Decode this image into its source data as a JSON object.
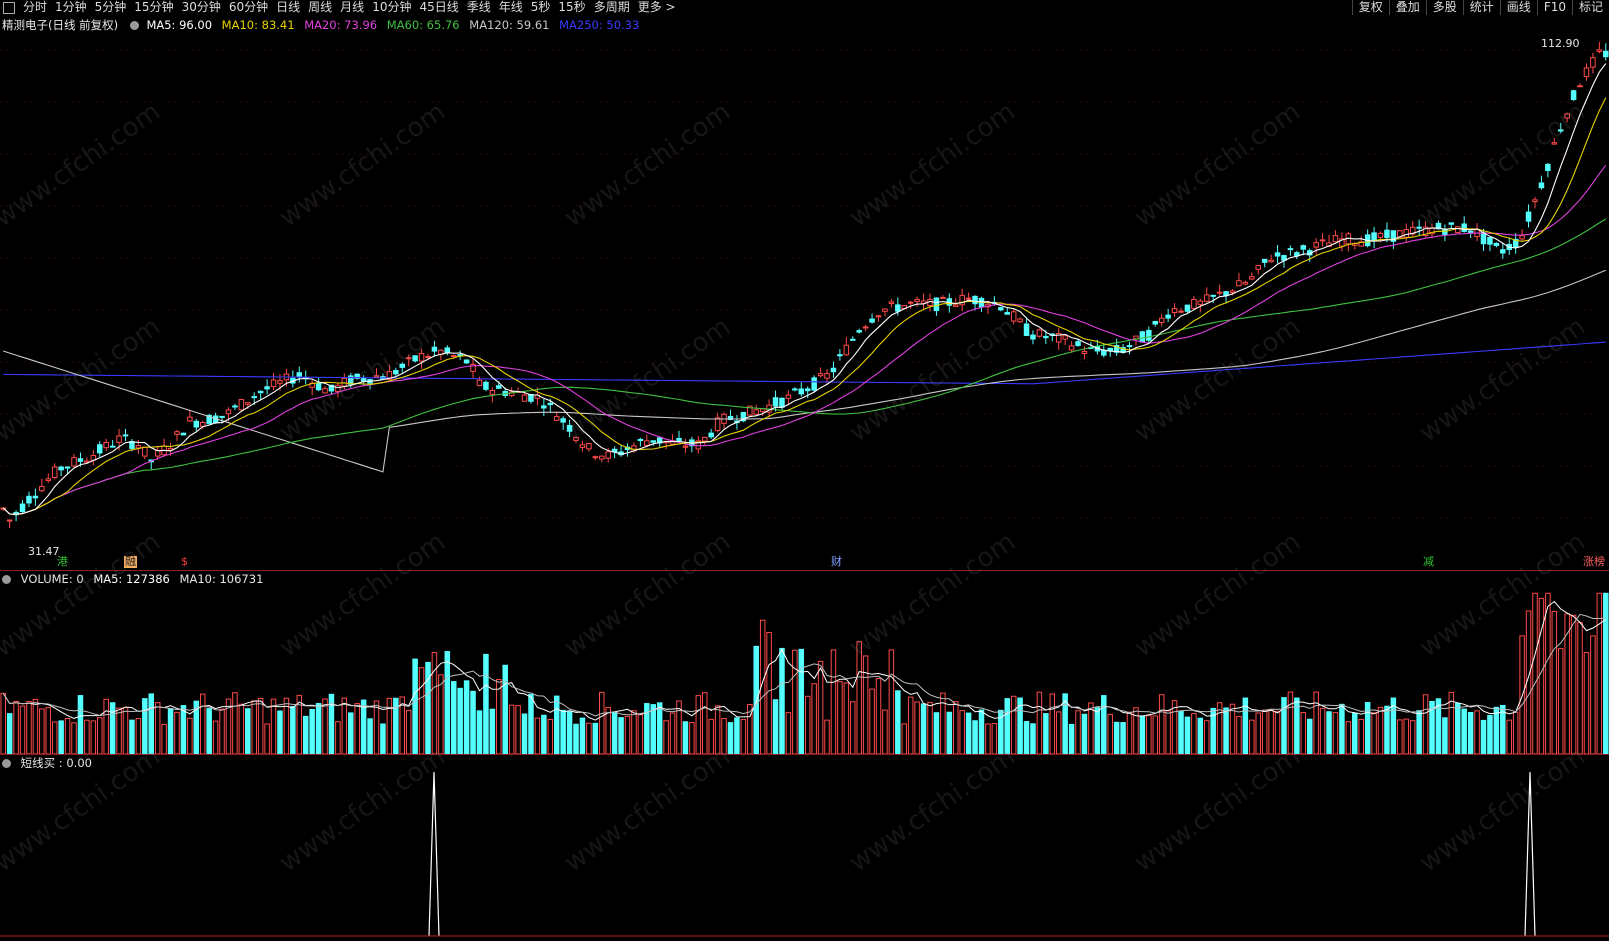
{
  "toolbar": {
    "periods": [
      "分时",
      "1分钟",
      "5分钟",
      "15分钟",
      "30分钟",
      "60分钟",
      "日线",
      "周线",
      "月线",
      "10分钟",
      "45日线",
      "季线",
      "年线",
      "5秒",
      "15秒",
      "多周期",
      "更多 >"
    ],
    "right": [
      "复权",
      "叠加",
      "多股",
      "统计",
      "画线",
      "F10",
      "标记"
    ]
  },
  "main_legend": {
    "title": "精测电子(日线 前复权)",
    "ma5": "MA5: 96.00",
    "ma10": "MA10: 83.41",
    "ma20": "MA20: 73.96",
    "ma60": "MA60: 65.76",
    "ma120": "MA120: 59.61",
    "ma250": "MA250: 50.33"
  },
  "price": {
    "high_label": "112.90",
    "low_label": "31.47"
  },
  "events": [
    "港",
    "融",
    "$",
    "财",
    "减",
    "涨榜"
  ],
  "volume_legend": {
    "volume": "VOLUME: 0",
    "ma5": "MA5: 127386",
    "ma10": "MA10: 106731"
  },
  "indicator_legend": {
    "label": "短线买 : 0.00"
  },
  "watermark": "www.cfchi.com",
  "colors": {
    "up": "#ff4a4a",
    "down": "#54ffff",
    "ma5": "#ffffff",
    "ma10": "#e6d200",
    "ma20": "#e040e0",
    "ma60": "#40c040",
    "ma120": "#c8c8c8",
    "ma250": "#3a3aff",
    "event_green": "#30c030",
    "event_orange": "#ffb060",
    "event_red": "#ff4040",
    "event_blue": "#80a0ff"
  }
}
